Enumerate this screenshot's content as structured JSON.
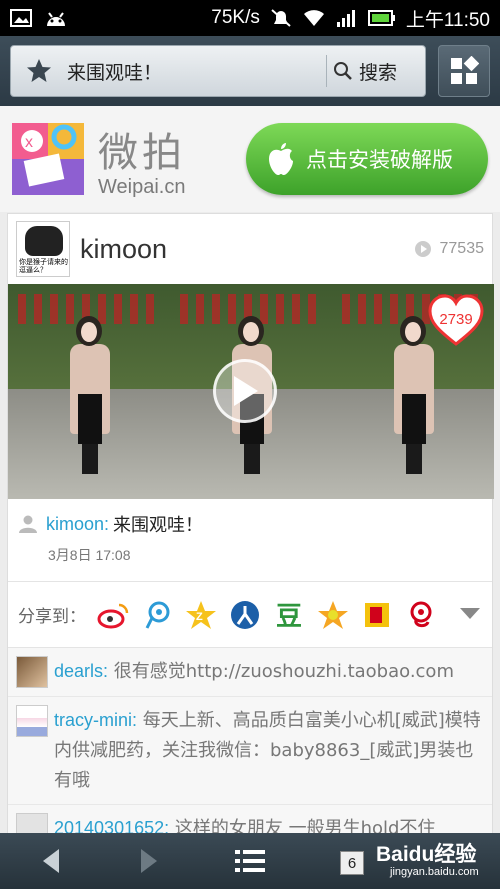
{
  "status_bar": {
    "network_speed": "75K/s",
    "time": "上午11:50",
    "icons": [
      "image-icon",
      "android-icon",
      "mute-icon",
      "wifi-icon",
      "signal-icon",
      "battery-icon"
    ]
  },
  "browser": {
    "address_text": "来围观哇！",
    "search_label": "搜索",
    "icons": [
      "star-icon",
      "search-icon",
      "grid-menu-icon"
    ]
  },
  "banner": {
    "logo_cn": "微拍",
    "logo_en": "Weipai.cn",
    "install_label": "点击安装破解版",
    "colors": {
      "install_green": "#4cbc35"
    }
  },
  "post": {
    "username": "kimoon",
    "avatar_caption": "你是猴子请来的逗逼么？",
    "play_count": "77535",
    "like_count": "2739",
    "caption_user": "kimoon:",
    "caption_text": "来围观哇！",
    "timestamp": "3月8日 17:08"
  },
  "share": {
    "label": "分享到：",
    "targets": [
      "weibo-icon",
      "tencent-weibo-icon",
      "qzone-icon",
      "renren-icon",
      "douban-icon",
      "kaixin-icon",
      "sohu-icon",
      "netease-icon",
      "expand-icon"
    ],
    "douban_char": "豆"
  },
  "comments": [
    {
      "user": "dearls:",
      "text": "很有感觉http://zuoshouzhi.taobao.com"
    },
    {
      "user": "tracy-mini:",
      "text": "每天上新、高品质白富美小心机[威武]模特内供减肥药，关注我微信：baby8863_[威武]男装也有哦"
    },
    {
      "user": "20140301652:",
      "text": "这样的女朋友 一般男生hold不住"
    }
  ],
  "bottom_nav": {
    "tab_count": "6",
    "watermark_main": "Baidu经验",
    "watermark_sub": "jingyan.baidu.com"
  }
}
